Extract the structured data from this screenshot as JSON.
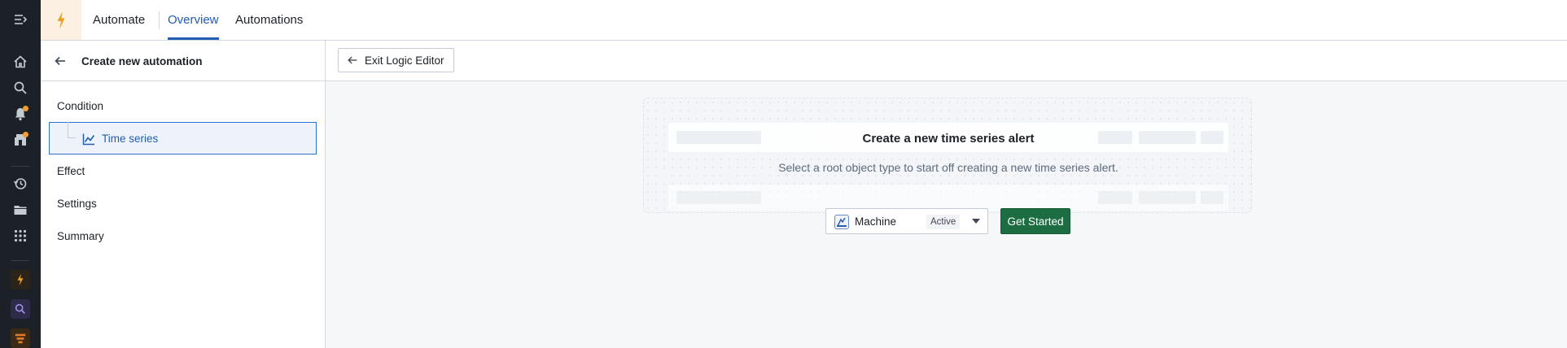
{
  "rail": {
    "items": [
      {
        "icon": "menu-expand-icon"
      },
      {
        "icon": "home-icon"
      },
      {
        "icon": "search-icon"
      },
      {
        "icon": "notifications-icon"
      },
      {
        "icon": "marketplace-icon"
      },
      {
        "icon": "history-icon"
      },
      {
        "icon": "folder-icon"
      },
      {
        "icon": "apps-grid-icon"
      },
      {
        "icon": "automate-app-icon"
      },
      {
        "icon": "search-app-icon"
      },
      {
        "icon": "pipeline-app-icon"
      }
    ],
    "accent": "#f0a030"
  },
  "topbar": {
    "app_name": "Automate",
    "tabs": [
      {
        "label": "Overview",
        "active": true
      },
      {
        "label": "Automations",
        "active": false
      }
    ],
    "active_color": "#215db0"
  },
  "sidebar": {
    "title": "Create new automation",
    "items": [
      {
        "label": "Condition"
      },
      {
        "label": "Time series",
        "selected": true,
        "icon": "timeline-line-chart-icon"
      },
      {
        "label": "Effect"
      },
      {
        "label": "Settings"
      },
      {
        "label": "Summary"
      }
    ]
  },
  "toolbar": {
    "exit_label": "Exit Logic Editor"
  },
  "empty_state": {
    "title": "Create a new time series alert",
    "subtitle": "Select a root object type to start off creating a new time series alert.",
    "object_type": {
      "label": "Machine",
      "badge": "Active"
    },
    "cta_label": "Get Started",
    "cta_color": "#1c6e42"
  }
}
